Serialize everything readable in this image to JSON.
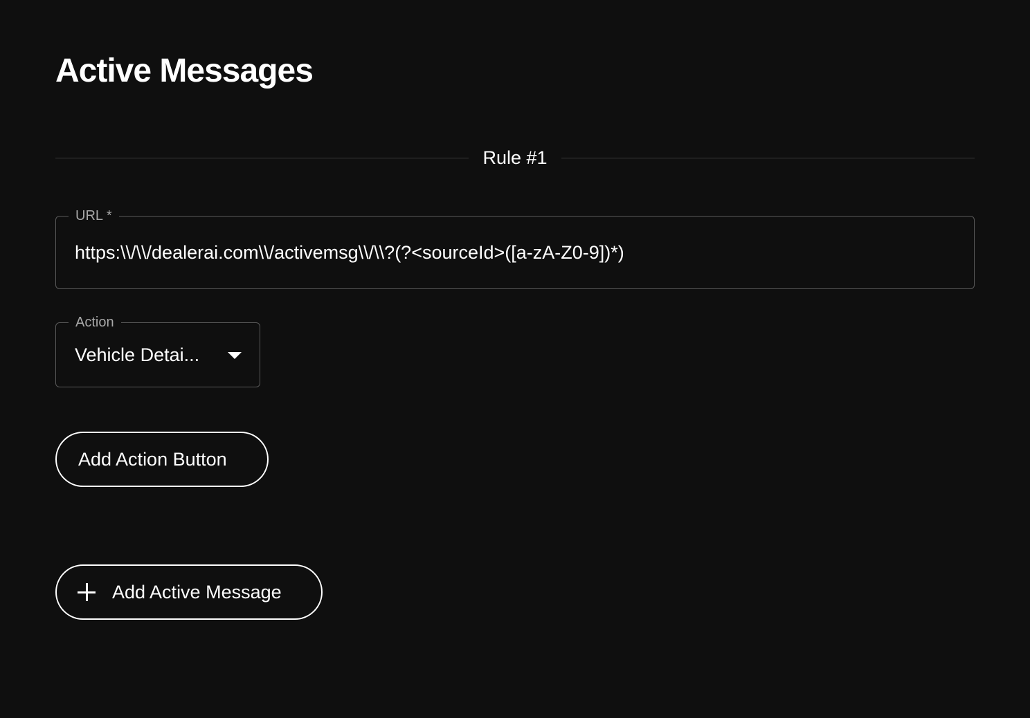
{
  "page": {
    "title": "Active Messages"
  },
  "rule": {
    "label": "Rule #1",
    "url_field": {
      "label": "URL *",
      "value": "https:\\\\/\\\\/dealerai.com\\\\/activemsg\\\\/\\\\?(?<sourceId>([a-zA-Z0-9])*)"
    },
    "action_field": {
      "label": "Action",
      "value": "Vehicle Detai..."
    },
    "add_action_button_label": "Add Action Button"
  },
  "add_active_message_label": "Add Active Message",
  "colors": {
    "background": "#0f0f0f",
    "text": "#ffffff",
    "field_border": "#5a5a5a",
    "label_muted": "#a8a8a8"
  },
  "icons": {
    "add_message": "plus-icon",
    "action_dropdown": "chevron-down-icon"
  }
}
